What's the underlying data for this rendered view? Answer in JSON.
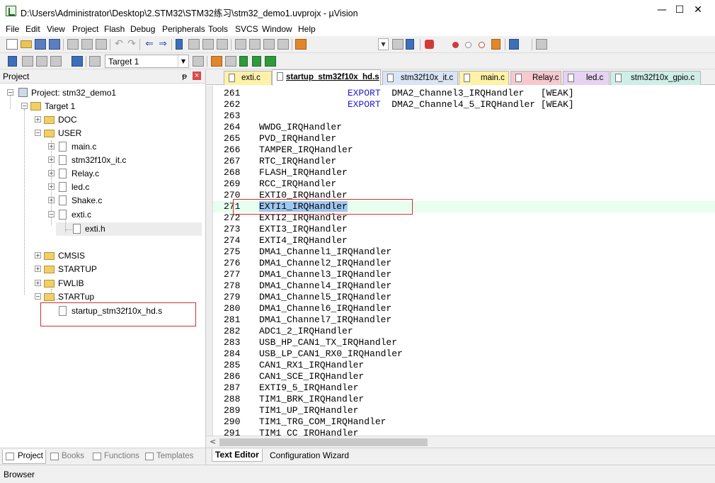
{
  "window": {
    "title": "D:\\Users\\Administrator\\Desktop\\2.STM32\\STM32练习\\stm32_demo1.uvprojx - µVision",
    "minimize": "—",
    "maximize": "☐",
    "close": "✕"
  },
  "menu": [
    "File",
    "Edit",
    "View",
    "Project",
    "Flash",
    "Debug",
    "Peripherals",
    "Tools",
    "SVCS",
    "Window",
    "Help"
  ],
  "toolbar2": {
    "target": "Target 1"
  },
  "project_panel": {
    "title": "Project",
    "pin": "ᵽ",
    "close": "×",
    "tree": {
      "project": "Project: stm32_demo1",
      "target": "Target 1",
      "groups": {
        "doc": "DOC",
        "user": "USER",
        "cmsis": "CMSIS",
        "startup": "STARTUP",
        "fwlib": "FWLIB",
        "startup2": "STARTup"
      },
      "files": {
        "main": "main.c",
        "it": "stm32f10x_it.c",
        "relay": "Relay.c",
        "led": "led.c",
        "shake": "Shake.c",
        "exti": "exti.c",
        "exti_h": "exti.h",
        "startup_s": "startup_stm32f10x_hd.s"
      },
      "expand": {
        "plus": "+",
        "minus": "−"
      }
    },
    "bottom_tabs": {
      "project": "Project",
      "books": "Books",
      "functions": "Functions",
      "templates": "Templates"
    }
  },
  "editor": {
    "tabs": [
      {
        "label": "exti.c",
        "color": "#fff2a8"
      },
      {
        "label": "startup_stm32f10x_hd.s",
        "color": "#ffffff"
      },
      {
        "label": "stm32f10x_it.c",
        "color": "#d9e4f5"
      },
      {
        "label": "main.c",
        "color": "#fff2a8"
      },
      {
        "label": "Relay.c",
        "color": "#f6c9cf"
      },
      {
        "label": "led.c",
        "color": "#e6d3f2"
      },
      {
        "label": "stm32f10x_gpio.c",
        "color": "#cfeee6"
      }
    ],
    "lines": [
      {
        "n": "261",
        "pre": "                ",
        "kw": "EXPORT",
        "post": "  DMA2_Channel3_IRQHandler   [WEAK]"
      },
      {
        "n": "262",
        "pre": "                ",
        "kw": "EXPORT",
        "post": "  DMA2_Channel4_5_IRQHandler [WEAK]"
      },
      {
        "n": "263",
        "pre": "",
        "kw": "",
        "post": ""
      },
      {
        "n": "264",
        "pre": "WWDG_IRQHandler",
        "kw": "",
        "post": ""
      },
      {
        "n": "265",
        "pre": "PVD_IRQHandler",
        "kw": "",
        "post": ""
      },
      {
        "n": "266",
        "pre": "TAMPER_IRQHandler",
        "kw": "",
        "post": ""
      },
      {
        "n": "267",
        "pre": "RTC_IRQHandler",
        "kw": "",
        "post": ""
      },
      {
        "n": "268",
        "pre": "FLASH_IRQHandler",
        "kw": "",
        "post": ""
      },
      {
        "n": "269",
        "pre": "RCC_IRQHandler",
        "kw": "",
        "post": ""
      },
      {
        "n": "270",
        "pre": "EXTI0_IRQHandler",
        "kw": "",
        "post": ""
      },
      {
        "n": "271",
        "pre": "",
        "kw": "",
        "post": "",
        "sel": "EXTI1_IRQHandler"
      },
      {
        "n": "272",
        "pre": "EXTI2_IRQHandler",
        "kw": "",
        "post": ""
      },
      {
        "n": "273",
        "pre": "EXTI3_IRQHandler",
        "kw": "",
        "post": ""
      },
      {
        "n": "274",
        "pre": "EXTI4_IRQHandler",
        "kw": "",
        "post": ""
      },
      {
        "n": "275",
        "pre": "DMA1_Channel1_IRQHandler",
        "kw": "",
        "post": ""
      },
      {
        "n": "276",
        "pre": "DMA1_Channel2_IRQHandler",
        "kw": "",
        "post": ""
      },
      {
        "n": "277",
        "pre": "DMA1_Channel3_IRQHandler",
        "kw": "",
        "post": ""
      },
      {
        "n": "278",
        "pre": "DMA1_Channel4_IRQHandler",
        "kw": "",
        "post": ""
      },
      {
        "n": "279",
        "pre": "DMA1_Channel5_IRQHandler",
        "kw": "",
        "post": ""
      },
      {
        "n": "280",
        "pre": "DMA1_Channel6_IRQHandler",
        "kw": "",
        "post": ""
      },
      {
        "n": "281",
        "pre": "DMA1_Channel7_IRQHandler",
        "kw": "",
        "post": ""
      },
      {
        "n": "282",
        "pre": "ADC1_2_IRQHandler",
        "kw": "",
        "post": ""
      },
      {
        "n": "283",
        "pre": "USB_HP_CAN1_TX_IRQHandler",
        "kw": "",
        "post": ""
      },
      {
        "n": "284",
        "pre": "USB_LP_CAN1_RX0_IRQHandler",
        "kw": "",
        "post": ""
      },
      {
        "n": "285",
        "pre": "CAN1_RX1_IRQHandler",
        "kw": "",
        "post": ""
      },
      {
        "n": "286",
        "pre": "CAN1_SCE_IRQHandler",
        "kw": "",
        "post": ""
      },
      {
        "n": "287",
        "pre": "EXTI9_5_IRQHandler",
        "kw": "",
        "post": ""
      },
      {
        "n": "288",
        "pre": "TIM1_BRK_IRQHandler",
        "kw": "",
        "post": ""
      },
      {
        "n": "289",
        "pre": "TIM1_UP_IRQHandler",
        "kw": "",
        "post": ""
      },
      {
        "n": "290",
        "pre": "TIM1_TRG_COM_IRQHandler",
        "kw": "",
        "post": ""
      },
      {
        "n": "291",
        "pre": "TIM1_CC_IRQHandler",
        "kw": "",
        "post": ""
      }
    ],
    "current_line": "271",
    "scroll_left_arrow": "<",
    "bottom_tabs": {
      "text_editor": "Text Editor",
      "config_wizard": "Configuration Wizard"
    }
  },
  "statusbar": {
    "text": "Browser"
  },
  "colors": {
    "keyword": "#1c1cd8",
    "current_line": "#e8ffef",
    "selection": "#9fc7ef",
    "annotation_box": "#d43030"
  }
}
